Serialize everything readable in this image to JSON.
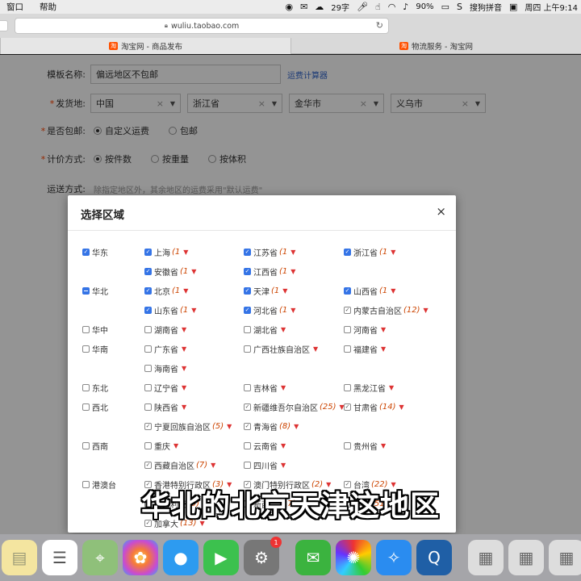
{
  "menubar": {
    "left_items": [
      "窗口",
      "帮助"
    ],
    "wordcount": "29字",
    "battery": "90%",
    "ime": "搜狗拼音",
    "clock": "周四 上午9:14"
  },
  "browser": {
    "url": "wuliu.taobao.com",
    "tabs": [
      {
        "favicon": "淘",
        "label": "淘宝网 - 商品发布"
      },
      {
        "favicon": "淘",
        "label": "物流服务 - 淘宝网"
      }
    ]
  },
  "form": {
    "template_label": "模板名称:",
    "template_value": "偏远地区不包邮",
    "calc_link": "运费计算器",
    "ship_from_label": "发货地:",
    "ship_from": [
      "中国",
      "浙江省",
      "金华市",
      "义乌市"
    ],
    "free_label": "是否包邮:",
    "free_options": [
      "自定义运费",
      "包邮"
    ],
    "pricing_label": "计价方式:",
    "pricing_options": [
      "按件数",
      "按重量",
      "按体积"
    ],
    "transport_label": "运送方式:",
    "transport_hint": "除指定地区外，其余地区的运费采用\"默认运费\""
  },
  "modal": {
    "title": "选择区域",
    "close": "×",
    "regions": [
      {
        "name": "华东",
        "state": "checked",
        "provinces": [
          {
            "name": "上海",
            "count": "(1",
            "state": "checked"
          },
          {
            "name": "江苏省",
            "count": "(1",
            "state": "checked"
          },
          {
            "name": "浙江省",
            "count": "(1",
            "state": "checked"
          },
          {
            "name": "安徽省",
            "count": "(1",
            "state": "checked"
          },
          {
            "name": "江西省",
            "count": "(1",
            "state": "checked"
          }
        ]
      },
      {
        "name": "华北",
        "state": "partial",
        "provinces": [
          {
            "name": "北京",
            "count": "(1",
            "state": "checked"
          },
          {
            "name": "天津",
            "count": "(1",
            "state": "checked"
          },
          {
            "name": "山西省",
            "count": "(1",
            "state": "checked"
          },
          {
            "name": "山东省",
            "count": "(1",
            "state": "checked"
          },
          {
            "name": "河北省",
            "count": "(1",
            "state": "checked"
          },
          {
            "name": "内蒙古自治区",
            "count": "(12)",
            "state": "partial"
          }
        ]
      },
      {
        "name": "华中",
        "state": "unchecked",
        "provinces": [
          {
            "name": "湖南省",
            "count": "",
            "state": "unchecked"
          },
          {
            "name": "湖北省",
            "count": "",
            "state": "unchecked"
          },
          {
            "name": "河南省",
            "count": "",
            "state": "unchecked"
          }
        ]
      },
      {
        "name": "华南",
        "state": "unchecked",
        "provinces": [
          {
            "name": "广东省",
            "count": "",
            "state": "unchecked"
          },
          {
            "name": "广西壮族自治区",
            "count": "",
            "state": "unchecked"
          },
          {
            "name": "福建省",
            "count": "",
            "state": "unchecked"
          },
          {
            "name": "海南省",
            "count": "",
            "state": "unchecked"
          }
        ]
      },
      {
        "name": "东北",
        "state": "unchecked",
        "provinces": [
          {
            "name": "辽宁省",
            "count": "",
            "state": "unchecked"
          },
          {
            "name": "吉林省",
            "count": "",
            "state": "unchecked"
          },
          {
            "name": "黑龙江省",
            "count": "",
            "state": "unchecked"
          }
        ]
      },
      {
        "name": "西北",
        "state": "unchecked",
        "provinces": [
          {
            "name": "陕西省",
            "count": "",
            "state": "unchecked"
          },
          {
            "name": "新疆维吾尔自治区",
            "count": "(25)",
            "state": "partial"
          },
          {
            "name": "甘肃省",
            "count": "(14)",
            "state": "partial"
          },
          {
            "name": "宁夏回族自治区",
            "count": "(5)",
            "state": "partial"
          },
          {
            "name": "青海省",
            "count": "(8)",
            "state": "partial"
          }
        ]
      },
      {
        "name": "西南",
        "state": "unchecked",
        "provinces": [
          {
            "name": "重庆",
            "count": "",
            "state": "unchecked"
          },
          {
            "name": "云南省",
            "count": "",
            "state": "unchecked"
          },
          {
            "name": "贵州省",
            "count": "",
            "state": "unchecked"
          },
          {
            "name": "西藏自治区",
            "count": "(7)",
            "state": "partial"
          },
          {
            "name": "四川省",
            "count": "",
            "state": "unchecked"
          }
        ]
      },
      {
        "name": "港澳台",
        "state": "unchecked",
        "provinces": [
          {
            "name": "香港特别行政区",
            "count": "(3)",
            "state": "partial"
          },
          {
            "name": "澳门特别行政区",
            "count": "(2)",
            "state": "partial"
          },
          {
            "name": "台湾",
            "count": "(22)",
            "state": "partial"
          }
        ]
      },
      {
        "name": "",
        "state": "none",
        "provinces": [
          {
            "name": "澳大利亚",
            "count": "(9)",
            "state": "partial"
          },
          {
            "name": "新西兰",
            "count": "(17)",
            "state": "partial"
          },
          {
            "name": "美国",
            "count": "(51)",
            "state": "partial"
          },
          {
            "name": "加拿大",
            "count": "(13)",
            "state": "partial"
          }
        ]
      }
    ]
  },
  "subtitle": "华北的北京天津这地区",
  "dock": {
    "badge_count": "1"
  },
  "colors": {
    "accent": "#3574e6",
    "count_red": "#cc4400",
    "required": "#ff4400"
  }
}
